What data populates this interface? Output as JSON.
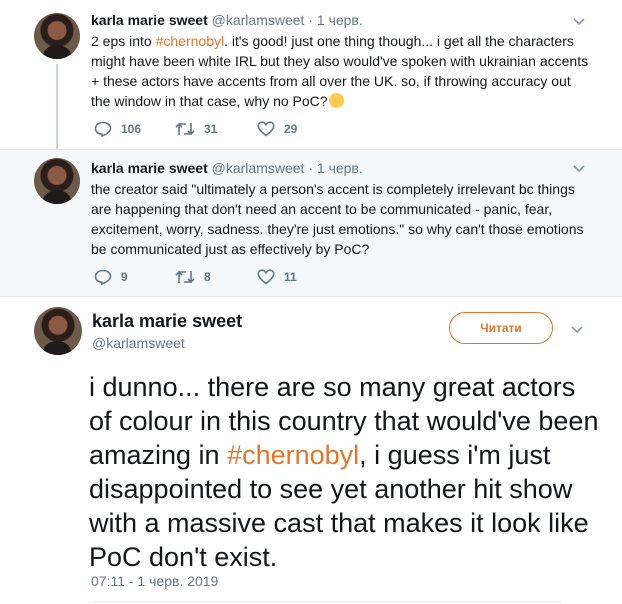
{
  "tweets": [
    {
      "name": "karla marie sweet",
      "handle": "@karlamsweet",
      "time": "1 черв.",
      "text_before": "2 eps into ",
      "hashtag": "#chernobyl",
      "text_after": ". it's good! just one thing though... i get all the characters might have been white IRL but they also would've spoken with ukrainian accents + these actors have accents from all over the UK. so, if throwing accuracy out the window in that case, why no PoC?",
      "replies": "106",
      "retweets": "31",
      "likes": "29"
    },
    {
      "name": "karla marie sweet",
      "handle": "@karlamsweet",
      "time": "1 черв.",
      "text": "the creator said \"ultimately a person's accent is completely irrelevant bc things are happening that don't need an accent to be communicated - panic, fear, excitement, worry, sadness. they're just emotions.\" so why can't those emotions be communicated just as effectively by PoC?",
      "replies": "9",
      "retweets": "8",
      "likes": "11"
    }
  ],
  "main": {
    "name": "karla marie sweet",
    "handle": "@karlamsweet",
    "follow_label": "Читати",
    "text_before": "i dunno... there are so many great actors of colour in this country that would've been amazing in ",
    "hashtag": "#chernobyl",
    "text_after": ", i guess i'm just disappointed to see yet another hit show with a massive cast that makes it look like PoC don't exist.",
    "timestamp": "07:11 - 1 черв. 2019"
  },
  "colors": {
    "accent": "#e2762c",
    "muted": "#657786",
    "text": "#14171a",
    "reply_bg": "#f5f8fa"
  },
  "icons": [
    "reply-icon",
    "retweet-icon",
    "like-icon",
    "chevron-down-icon",
    "thinking-face-emoji"
  ]
}
